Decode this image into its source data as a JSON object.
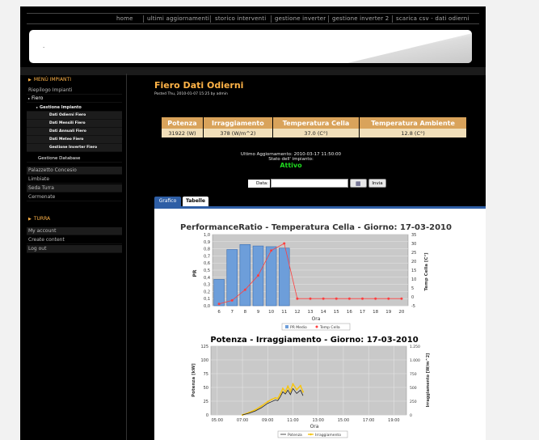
{
  "topnav": [
    "home",
    "ultimi aggiornamenti",
    "storico interventi",
    "gestione inverter",
    "gestione inverter 2",
    "scarica csv - dati odierni"
  ],
  "banner_text": ".",
  "sidebar": {
    "impianti_header": "MENÙ IMPIANTI",
    "riepilogo": "Riepilogo Impianti",
    "fiero": "Fiero",
    "gestione_impianto": "Gestione Impianto",
    "sub_items": [
      "Dati Odierni Fiero",
      "Dati Mensili Fiero",
      "Dati Annuali Fiero",
      "Dati Meteo Fiero",
      "Gestione Inverter Fiero"
    ],
    "gestione_database": "Gestione Database",
    "plants": [
      "Palazzetto Concesio",
      "Limbiate",
      "Seda Turra",
      "Cermenate"
    ],
    "turra_header": "TURRA",
    "account": [
      "My account",
      "Create content",
      "Log out"
    ]
  },
  "main": {
    "title": "Fiero Dati Odierni",
    "posted": "Posted Thu, 2010-01-07 15:25 by admin",
    "kpi_headers": [
      "Potenza",
      "Irraggiamento",
      "Temperatura Cella",
      "Temperatura Ambiente"
    ],
    "kpi_values": [
      "31922 (W)",
      "378 (W/m^2)",
      "37.0 (C°)",
      "12.8 (C°)"
    ],
    "last_update": "Ultimo Aggiornamento: 2010-03-17 11:50:00",
    "stato_label": "Stato dell' impianto:",
    "stato_value": "Attivo",
    "data_label": "Data:",
    "data_value": "",
    "invia_label": "Invia",
    "tabs": [
      "Grafico",
      "Tabelle"
    ]
  },
  "colors": {
    "accent": "#ffb347",
    "tab_blue": "#2e5ea5",
    "active_green": "#1fdc1f",
    "bar_blue": "#6d9eda",
    "line_red": "#ff3f3f",
    "irr_yellow": "#f5c518"
  },
  "chart_data": [
    {
      "type": "bar",
      "title": "PerformanceRatio - Temperatura Cella - Giorno: 17-03-2010",
      "xlabel": "Ora",
      "ylabel": "PR",
      "y2label": "Temp Cella [C°]",
      "categories": [
        "6",
        "7",
        "8",
        "9",
        "10",
        "11",
        "12",
        "13",
        "14",
        "15",
        "16",
        "17",
        "18",
        "19",
        "20"
      ],
      "ylim": [
        0,
        1.0
      ],
      "yticks": [
        "0,0",
        "0,1",
        "0,2",
        "0,3",
        "0,4",
        "0,5",
        "0,6",
        "0,7",
        "0,8",
        "0,9",
        "1,0"
      ],
      "y2lim": [
        -5,
        35
      ],
      "y2ticks": [
        "-5",
        "0",
        "5",
        "10",
        "15",
        "20",
        "25",
        "30",
        "35"
      ],
      "series": [
        {
          "name": "PR Medio",
          "kind": "bar",
          "values": [
            0.37,
            0.79,
            0.86,
            0.84,
            0.83,
            0.81,
            null,
            null,
            null,
            null,
            null,
            null,
            null,
            null,
            null
          ]
        },
        {
          "name": "Temp Cella",
          "kind": "line",
          "values": [
            -4,
            -2,
            4,
            12,
            26,
            30,
            -1,
            -1,
            -1,
            -1,
            -1,
            -1,
            -1,
            -1,
            -1
          ]
        }
      ],
      "legend": "bottom"
    },
    {
      "type": "line",
      "title": "Potenza - Irraggiamento - Giorno: 17-03-2010",
      "xlabel": "Ora",
      "ylabel": "Potenza [kW]",
      "y2label": "Irraggiamento [W/m^2]",
      "xticks": [
        "05:00",
        "07:00",
        "09:00",
        "11:00",
        "13:00",
        "15:00",
        "17:00",
        "19:00"
      ],
      "xlim": [
        4.5,
        20
      ],
      "ylim": [
        0,
        125
      ],
      "yticks": [
        "0",
        "25",
        "50",
        "75",
        "100",
        "125"
      ],
      "y2lim": [
        0,
        1250
      ],
      "y2ticks": [
        "0",
        "250",
        "500",
        "750",
        "1.000",
        "1.250"
      ],
      "series": [
        {
          "name": "Potenza",
          "x": [
            7.0,
            7.5,
            8.0,
            8.5,
            9.0,
            9.3,
            9.6,
            9.8,
            10.0,
            10.2,
            10.4,
            10.6,
            10.8,
            11.0,
            11.3,
            11.6,
            11.8
          ],
          "values": [
            0,
            3,
            7,
            13,
            21,
            24,
            27,
            26,
            33,
            42,
            38,
            45,
            37,
            48,
            39,
            45,
            35
          ]
        },
        {
          "name": "Irraggiamento",
          "x": [
            7.0,
            7.5,
            8.0,
            8.5,
            9.0,
            9.3,
            9.6,
            9.8,
            10.0,
            10.2,
            10.4,
            10.6,
            10.8,
            11.0,
            11.3,
            11.6,
            11.8
          ],
          "values": [
            0,
            40,
            90,
            160,
            240,
            280,
            310,
            300,
            380,
            480,
            420,
            520,
            430,
            560,
            460,
            530,
            420
          ]
        }
      ],
      "legend": "bottom"
    }
  ]
}
